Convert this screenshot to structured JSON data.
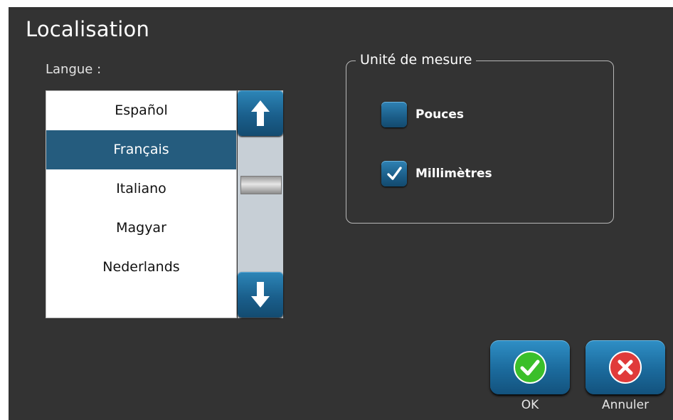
{
  "dialog": {
    "title": "Localisation"
  },
  "language": {
    "label": "Langue :",
    "items": [
      "Español",
      "Français",
      "Italiano",
      "Magyar",
      "Nederlands"
    ],
    "selected": "Français"
  },
  "units": {
    "legend": "Unité de mesure",
    "options": [
      {
        "label": "Pouces",
        "checked": false
      },
      {
        "label": "Millimètres",
        "checked": true
      }
    ]
  },
  "actions": {
    "ok_label": "OK",
    "cancel_label": "Annuler"
  },
  "icons": {
    "scroll_up": "arrow-up-icon",
    "scroll_down": "arrow-down-icon",
    "ok": "check-circle-icon",
    "cancel": "x-circle-icon",
    "checked": "checkmark-icon"
  },
  "colors": {
    "background": "#333333",
    "selection": "#255c7e",
    "button_blue": "#1b6a9c",
    "ok_green": "#3bbf2a",
    "cancel_red": "#e03a3a"
  }
}
